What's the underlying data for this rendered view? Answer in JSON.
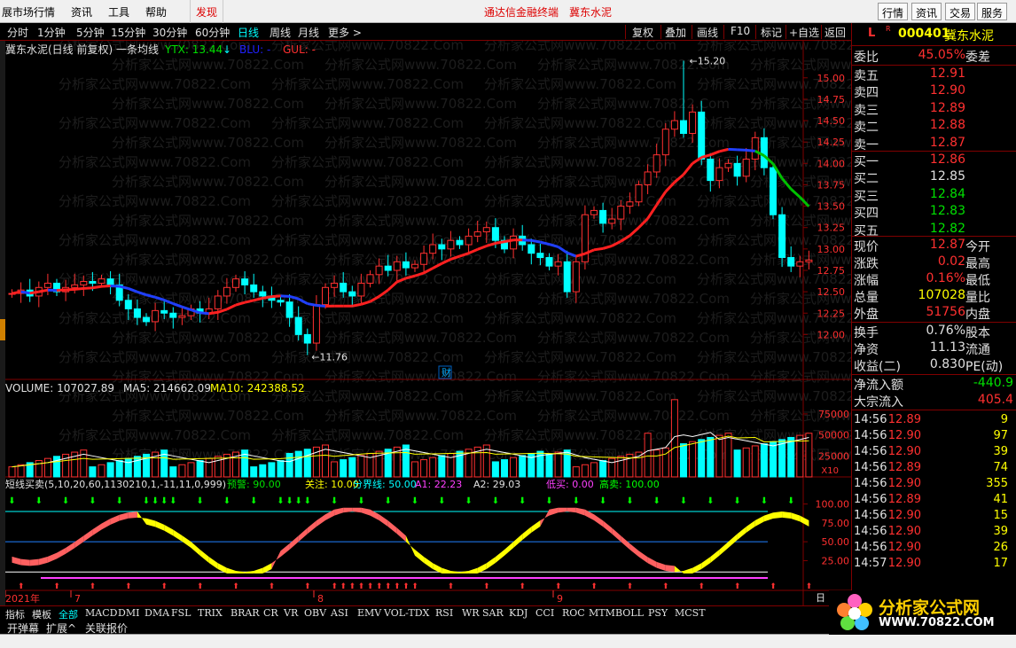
{
  "menu": {
    "items": [
      "展市场行情",
      "资讯",
      "工具",
      "帮助"
    ],
    "discover": "发现",
    "app_title": "通达信金融终端",
    "stock_title": "冀东水泥",
    "right_buttons": [
      "行情",
      "资讯",
      "交易",
      "服务"
    ]
  },
  "toolbar": {
    "periods": [
      "分时",
      "1分钟",
      "5分钟",
      "15分钟",
      "30分钟",
      "60分钟",
      "日线",
      "周线",
      "月线",
      "更多 >"
    ],
    "active_period": "日线",
    "right": [
      "复权",
      "叠加",
      "画线",
      "F10",
      "标记",
      "+自选",
      "返回"
    ]
  },
  "chart": {
    "main_title": "冀东水泥(日线 前复权) 一条均线",
    "ytx": "YTX: 13.44",
    "blu": "BLU: -",
    "gul": "GUL: -",
    "price_ticks": [
      "15.00",
      "14.75",
      "14.50",
      "14.25",
      "14.00",
      "13.75",
      "13.50",
      "13.25",
      "13.00",
      "12.75",
      "12.50",
      "12.25",
      "12.00"
    ],
    "high_label": "15.20",
    "low_label": "11.76",
    "cai_label": "财",
    "volume_title": "VOLUME: 107027.89",
    "ma5": "MA5: 214662.09",
    "ma10": "MA10: 242388.52",
    "vol_ticks": [
      "75000",
      "50000",
      "25000"
    ],
    "vol_unit": "X10",
    "indicator_title": "短线买卖(5,10,20,60,1130210,1,-11,11,0,999)",
    "ind_items": [
      "预警: 90.00",
      "关注: 10.00",
      "分界线: 50.00",
      "A1: 22.23",
      "A2: 29.03",
      "低买: 0.00",
      "高卖: 100.00"
    ],
    "ind_ticks": [
      "100.00",
      "75.00",
      "50.00",
      "25.00"
    ],
    "date_labels": [
      "2021年",
      "7",
      "8",
      "9"
    ],
    "day_label": "日",
    "watermark": "分析家公式网www.70822.Com"
  },
  "indicator_tabs": [
    "指标",
    "模板",
    "全部",
    "MACD",
    "DMI",
    "DMA",
    "FSL",
    "TRIX",
    "BRAR",
    "CR",
    "VR",
    "OBV",
    "ASI",
    "EMV",
    "VOL-TDX",
    "RSI",
    "WR",
    "SAR",
    "KDJ",
    "CCI",
    "ROC",
    "MTM",
    "BOLL",
    "PSY",
    "MCST"
  ],
  "bottom_buttons": [
    "开弹幕",
    "扩展^",
    "关联报价"
  ],
  "quote": {
    "code": "000401",
    "name": "冀东水泥",
    "weibi_label": "委比",
    "weibi": "45.05%",
    "weicha_label": "委差",
    "asks": [
      {
        "label": "卖五",
        "price": "12.91"
      },
      {
        "label": "卖四",
        "price": "12.90"
      },
      {
        "label": "卖三",
        "price": "12.89"
      },
      {
        "label": "卖二",
        "price": "12.88"
      },
      {
        "label": "卖一",
        "price": "12.87"
      }
    ],
    "bids": [
      {
        "label": "买一",
        "price": "12.86"
      },
      {
        "label": "买二",
        "price": "12.85"
      },
      {
        "label": "买三",
        "price": "12.84"
      },
      {
        "label": "买四",
        "price": "12.83"
      },
      {
        "label": "买五",
        "price": "12.82"
      }
    ],
    "stats": [
      {
        "l1": "现价",
        "v1": "12.87",
        "l2": "今开"
      },
      {
        "l1": "涨跌",
        "v1": "0.02",
        "l2": "最高"
      },
      {
        "l1": "涨幅",
        "v1": "0.16%",
        "l2": "最低"
      },
      {
        "l1": "总量",
        "v1": "107028",
        "l2": "量比"
      },
      {
        "l1": "外盘",
        "v1": "51756",
        "l2": "内盘"
      }
    ],
    "stats2": [
      {
        "l1": "换手",
        "v1": "0.76%",
        "l2": "股本"
      },
      {
        "l1": "净资",
        "v1": "11.13",
        "l2": "流通"
      },
      {
        "l1": "收益(二)",
        "v1": "0.830",
        "l2": "PE(动)"
      }
    ],
    "flow": [
      {
        "label": "净流入额",
        "value": "-440.9"
      },
      {
        "label": "大宗流入",
        "value": "405.4"
      }
    ],
    "ticks": [
      {
        "t": "14:56",
        "p": "12.89",
        "v": "9"
      },
      {
        "t": "14:56",
        "p": "12.90",
        "v": "97"
      },
      {
        "t": "14:56",
        "p": "12.90",
        "v": "39"
      },
      {
        "t": "14:56",
        "p": "12.89",
        "v": "74"
      },
      {
        "t": "14:56",
        "p": "12.90",
        "v": "355"
      },
      {
        "t": "14:56",
        "p": "12.89",
        "v": "41"
      },
      {
        "t": "14:56",
        "p": "12.90",
        "v": "15"
      },
      {
        "t": "14:56",
        "p": "12.90",
        "v": "39"
      },
      {
        "t": "14:56",
        "p": "12.90",
        "v": "26"
      },
      {
        "t": "14:57",
        "p": "12.90",
        "v": "17"
      }
    ]
  },
  "logo": {
    "text": "分析家公式网",
    "url": "WWW.70822.COM"
  }
}
